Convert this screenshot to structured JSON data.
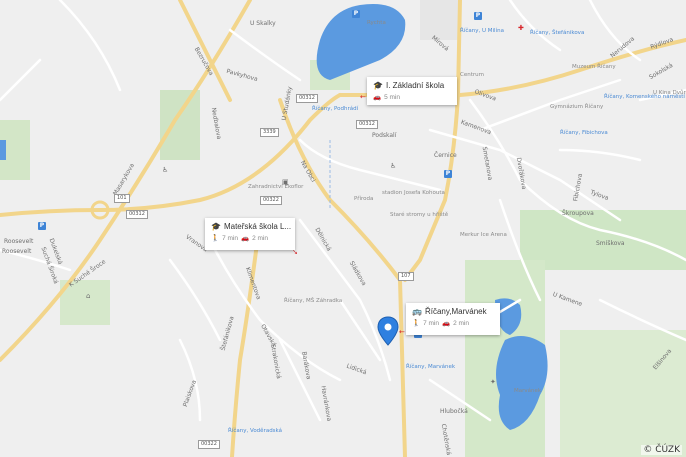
{
  "attribution": "© ČÚZK",
  "cards": [
    {
      "title": "I. Základní škola",
      "meta": [
        {
          "icon": "car-icon",
          "text": "5 min"
        }
      ]
    },
    {
      "title": "Mateřská škola L...",
      "meta": [
        {
          "icon": "walk-icon",
          "text": "7 min"
        },
        {
          "icon": "car-icon",
          "text": "2 min"
        }
      ]
    },
    {
      "title": "Říčany,Marvánek",
      "meta": [
        {
          "icon": "walk-icon",
          "text": "7 min"
        },
        {
          "icon": "car-icon",
          "text": "2 min"
        }
      ]
    }
  ],
  "road_shields": [
    "00312",
    "3339",
    "00312",
    "00312",
    "00322",
    "101",
    "107",
    "00322",
    "00312"
  ],
  "street_labels": [
    "Bezručova",
    "Pavkyhova",
    "U Skalky",
    "Nedbalova",
    "U Studánky",
    "Podskalí",
    "Na Obci",
    "Kamenova",
    "Černice",
    "Olivova",
    "Smetanova",
    "Dvořákova",
    "Sokolská",
    "Rýdlova",
    "Nerudova",
    "Tylova",
    "Škroupova",
    "Fibichova",
    "Smíškova",
    "Roosevelt",
    "Masarykova",
    "Vranova",
    "Dělnická",
    "Sládkova",
    "Klimentova",
    "Roosveltova",
    "Dukelská",
    "Suchá Široká",
    "K Suché Šroce",
    "Pražská",
    "Štefánikova",
    "Otavská",
    "Strakonická",
    "Barákova",
    "Lidická",
    "Heyrovského",
    "Hlubočká",
    "Chotěnská",
    "U Kamene",
    "Elšinova",
    "Plaiskova",
    "Havránkova",
    "Smiřická",
    "Mírová"
  ],
  "pois": [
    "Rychta",
    "Říčany, U Milína",
    "Říčany, Štefánikova",
    "Říčany, Podhrádí",
    "Centrum",
    "Muzeum Říčany",
    "Říčany, Komenského náměstí",
    "Gymnázium Říčany",
    "Říčany, Fibichova",
    "Zahradnictví Ekoflor",
    "Přírodа",
    "stadion Josefa Kohouta",
    "Staré stromy u hřiště",
    "Merkur Ice Arena",
    "Říčany, MŠ Záhradka",
    "Říčany, Marvánek",
    "Marvánek",
    "Říčany, Voděradská",
    "Pošta",
    "U Kina Dvůr",
    "Náměstí"
  ],
  "route_number": "107",
  "highway_number": "101"
}
